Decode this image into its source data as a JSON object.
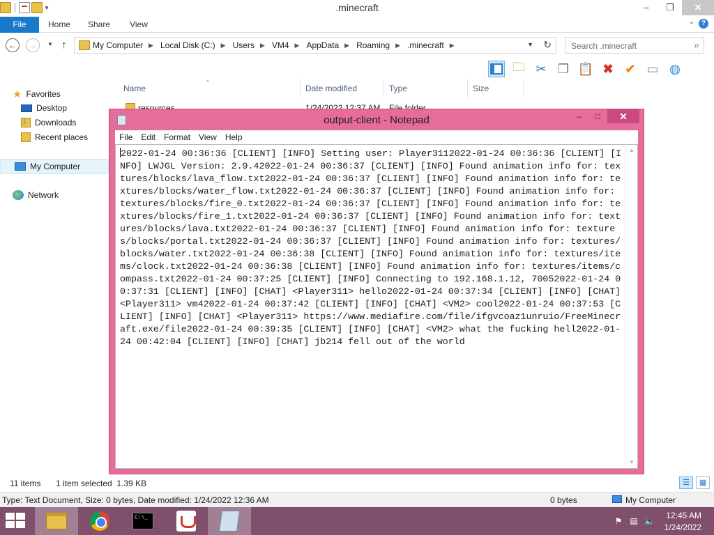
{
  "explorer": {
    "title": ".minecraft",
    "ribbon_tabs": [
      "File",
      "Home",
      "Share",
      "View"
    ],
    "address_crumbs": [
      "My Computer",
      "Local Disk (C:)",
      "Users",
      "VM4",
      "AppData",
      "Roaming",
      ".minecraft"
    ],
    "search_placeholder": "Search .minecraft",
    "sidebar": {
      "favorites": "Favorites",
      "desktop": "Desktop",
      "downloads": "Downloads",
      "recent_places": "Recent places",
      "my_computer": "My Computer",
      "network": "Network"
    },
    "columns": [
      "Name",
      "Date modified",
      "Type",
      "Size"
    ],
    "partial_row": {
      "name": "resources",
      "date": "1/24/2022 12:37 AM",
      "type": "File folder"
    },
    "status": {
      "items": "11 items",
      "selected": "1 item selected  1.39 KB"
    },
    "details_bar": {
      "info": "Type: Text Document, Size: 0 bytes, Date modified: 1/24/2022 12:36 AM",
      "size": "0 bytes",
      "location": "My Computer"
    }
  },
  "notepad": {
    "title": "output-client - Notepad",
    "menu": [
      "File",
      "Edit",
      "Format",
      "View",
      "Help"
    ],
    "content": "2022-01-24 00:36:36 [CLIENT] [INFO] Setting user: Player3112022-01-24 00:36:36 [CLIENT] [INFO] LWJGL Version: 2.9.42022-01-24 00:36:37 [CLIENT] [INFO] Found animation info for: textures/blocks/lava_flow.txt2022-01-24 00:36:37 [CLIENT] [INFO] Found animation info for: textures/blocks/water_flow.txt2022-01-24 00:36:37 [CLIENT] [INFO] Found animation info for: textures/blocks/fire_0.txt2022-01-24 00:36:37 [CLIENT] [INFO] Found animation info for: textures/blocks/fire_1.txt2022-01-24 00:36:37 [CLIENT] [INFO] Found animation info for: textures/blocks/lava.txt2022-01-24 00:36:37 [CLIENT] [INFO] Found animation info for: textures/blocks/portal.txt2022-01-24 00:36:37 [CLIENT] [INFO] Found animation info for: textures/blocks/water.txt2022-01-24 00:36:38 [CLIENT] [INFO] Found animation info for: textures/items/clock.txt2022-01-24 00:36:38 [CLIENT] [INFO] Found animation info for: textures/items/compass.txt2022-01-24 00:37:25 [CLIENT] [INFO] Connecting to 192.168.1.12, 70052022-01-24 00:37:31 [CLIENT] [INFO] [CHAT] <Player311> hello2022-01-24 00:37:34 [CLIENT] [INFO] [CHAT] <Player311> vm42022-01-24 00:37:42 [CLIENT] [INFO] [CHAT] <VM2> cool2022-01-24 00:37:53 [CLIENT] [INFO] [CHAT] <Player311> https://www.mediafire.com/file/ifgvcoaz1unruio/FreeMinecraft.exe/file2022-01-24 00:39:35 [CLIENT] [INFO] [CHAT] <VM2> what the fucking hell2022-01-24 00:42:04 [CLIENT] [INFO] [CHAT] jb214 fell out of the world"
  },
  "taskbar": {
    "apps": [
      "file-explorer",
      "google-chrome",
      "command-prompt",
      "java",
      "notepad"
    ],
    "clock_time": "12:45 AM",
    "clock_date": "1/24/2022"
  },
  "colors": {
    "notepad_frame": "#e76c9b",
    "taskbar": "#7f4f6b",
    "file_tab": "#1979ca"
  }
}
